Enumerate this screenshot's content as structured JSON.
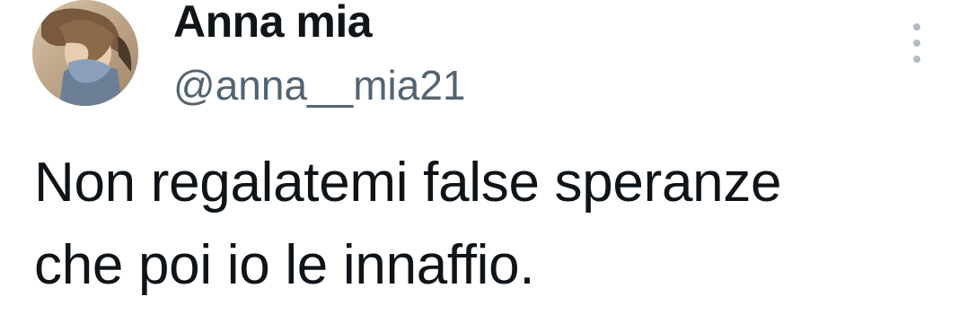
{
  "tweet": {
    "author": {
      "display_name": "Anna mia",
      "handle": "@anna__mia21",
      "avatar_icon": "profile-photo"
    },
    "more_icon": "vertical-ellipsis-icon",
    "text_lines": [
      "Non regalatemi false speranze",
      "che poi io le innaffio."
    ]
  },
  "colors": {
    "text_primary": "#0f1419",
    "text_secondary": "#536471",
    "icon_muted": "#b3bcc4",
    "background": "#ffffff"
  }
}
